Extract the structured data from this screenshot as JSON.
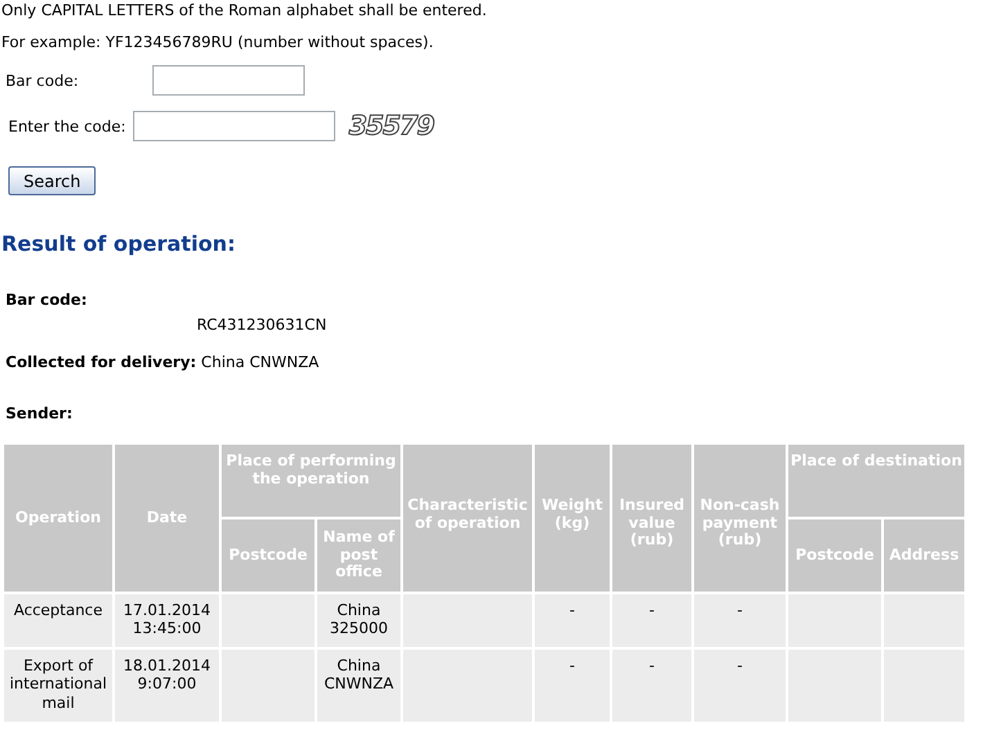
{
  "notes": [
    "Only CAPITAL LETTERS of the Roman alphabet shall be entered.",
    "For example: YF123456789RU (number without spaces)."
  ],
  "form": {
    "barcode_label": "Bar code:",
    "code_label": "Enter the code:",
    "captcha": "35579",
    "search_button": "Search"
  },
  "result": {
    "title": "Result of operation:",
    "barcode_label": "Bar code:",
    "barcode": "RC431230631CN",
    "collected_label": "Collected for delivery:",
    "collected": "China CNWNZA",
    "sender_label": "Sender:"
  },
  "table": {
    "columns": {
      "operation": "Operation",
      "date": "Date",
      "place": "Place of performing the operation",
      "postcode": "Postcode",
      "post_office": "Name of post office",
      "characteristic": "Characteristic of operation",
      "weight": "Weight (kg)",
      "insured": "Insured value (rub)",
      "non_cash": "Non-cash payment (rub)",
      "destination": "Place of destination",
      "dest_postcode": "Postcode",
      "dest_address": "Address"
    },
    "rows": [
      {
        "operation": "Acceptance",
        "date": [
          "17.01.2014",
          "13:45:00"
        ],
        "post_office": [
          "China",
          "325000"
        ],
        "weight": "-",
        "insured": "-",
        "non_cash": "-"
      },
      {
        "operation": "Export of international mail",
        "date": [
          "18.01.2014",
          "9:07:00"
        ],
        "post_office": [
          "China",
          "CNWNZA"
        ],
        "weight": "-",
        "insured": "-",
        "non_cash": "-"
      }
    ]
  }
}
